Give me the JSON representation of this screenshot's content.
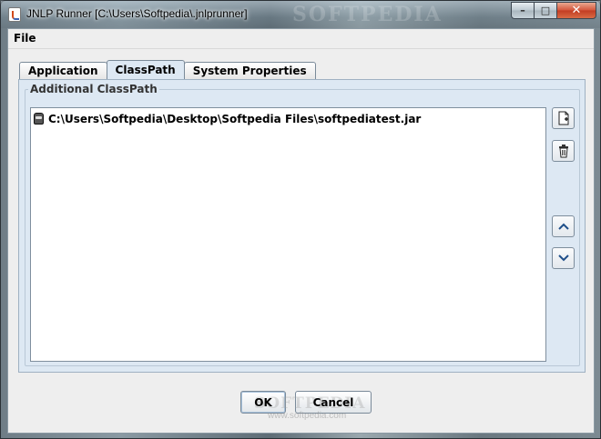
{
  "window": {
    "title": "JNLP Runner [C:\\Users\\Softpedia\\.jnlprunner]",
    "watermark": "SOFTPEDIA",
    "controls": {
      "minimize": "–",
      "maximize": "□",
      "close": "✕"
    }
  },
  "menu": {
    "file_label": "File"
  },
  "tabs": [
    {
      "label": "Application",
      "active": false
    },
    {
      "label": "ClassPath",
      "active": true
    },
    {
      "label": "System Properties",
      "active": false
    }
  ],
  "classpath": {
    "group_title": "Additional ClassPath",
    "items": [
      {
        "label": "C:\\Users\\Softpedia\\Desktop\\Softpedia Files\\softpediatest.jar",
        "icon": "jar-icon"
      }
    ],
    "side_buttons": [
      {
        "name": "add-button",
        "icon": "add-file-icon"
      },
      {
        "name": "delete-button",
        "icon": "trash-icon"
      },
      {
        "name": "move-up-button",
        "icon": "chevron-up-icon"
      },
      {
        "name": "move-down-button",
        "icon": "chevron-down-icon"
      }
    ]
  },
  "buttons": {
    "ok": "OK",
    "cancel": "Cancel"
  },
  "watermark_bottom": {
    "text": "SOFTPEDIA",
    "url": "www.softpedia.com"
  },
  "colors": {
    "panel": "#dde8f3",
    "client": "#eeeeee",
    "border": "#7a8a99",
    "close_button": "#c23c22"
  }
}
